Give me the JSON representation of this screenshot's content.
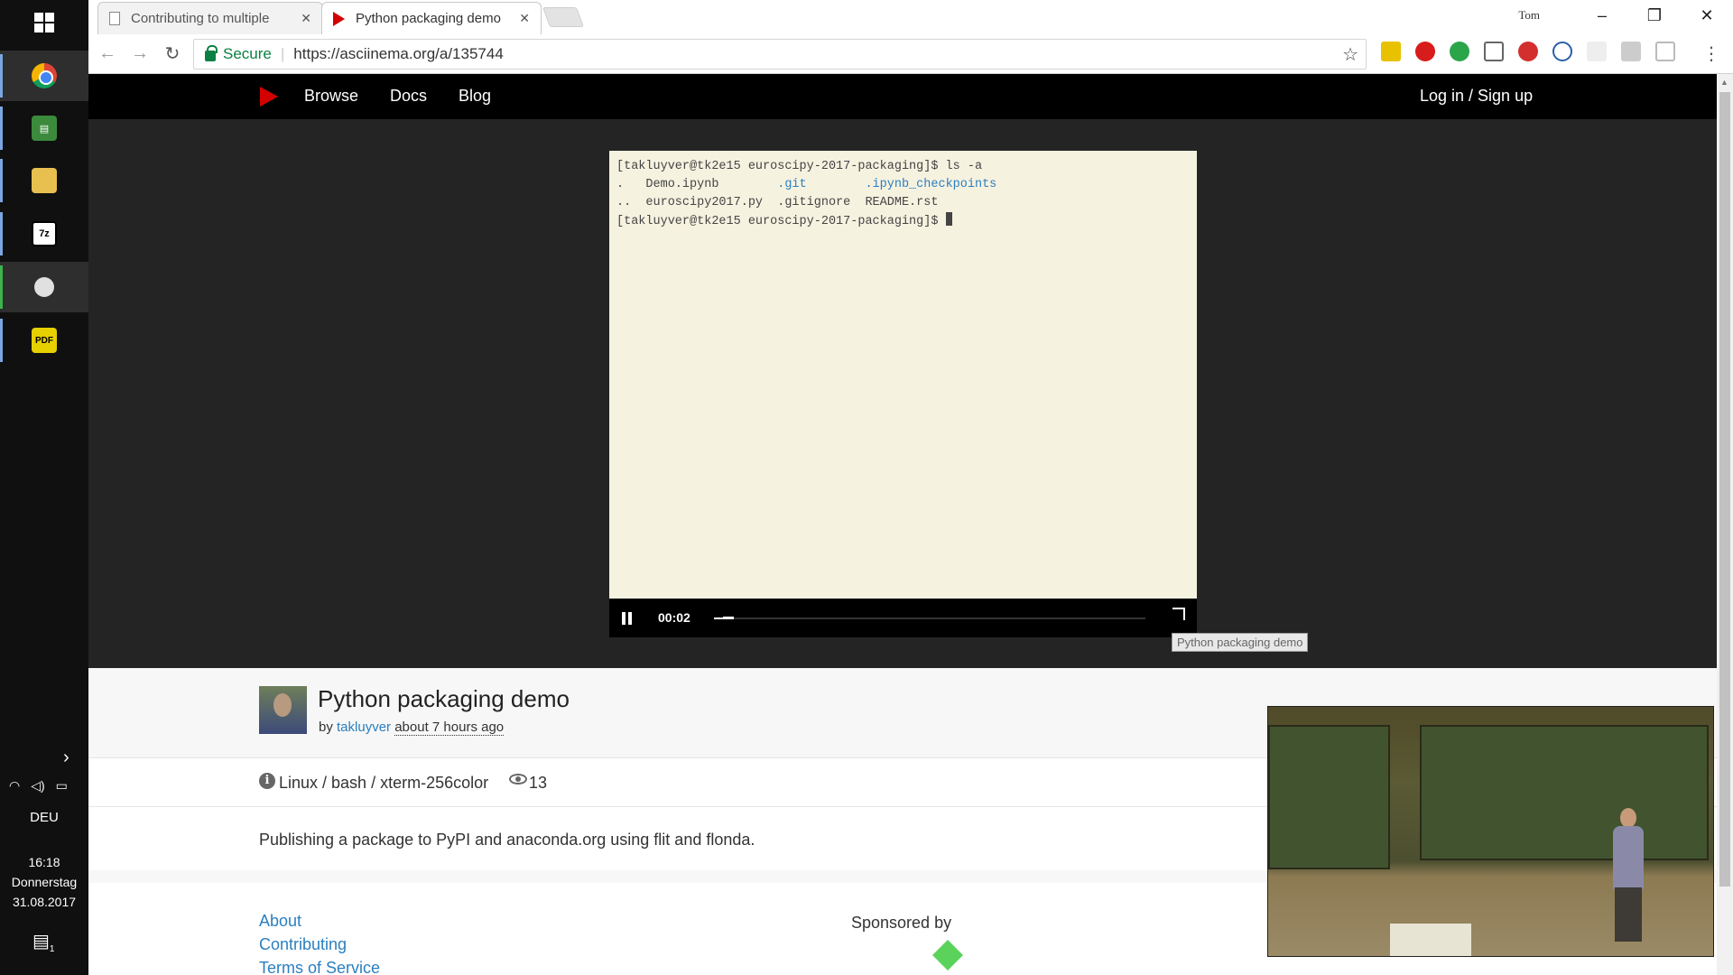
{
  "taskbar": {
    "apps": [
      "chrome",
      "spreadsheet",
      "file-explorer",
      "7zip",
      "media-player",
      "pdf-reader"
    ],
    "language": "DEU",
    "time": "16:18",
    "day": "Donnerstag",
    "date": "31.08.2017",
    "notifications": "1"
  },
  "browser": {
    "tabs": [
      {
        "title": "Contributing to multiple",
        "active": false
      },
      {
        "title": "Python packaging demo",
        "active": true
      }
    ],
    "user": "Tom",
    "secure_label": "Secure",
    "url": "https://asciinema.org/a/135744"
  },
  "site": {
    "nav": [
      "Browse",
      "Docs",
      "Blog"
    ],
    "login": "Log in / Sign up"
  },
  "terminal": {
    "line1": "[takluyver@tk2e15 euroscipy-2017-packaging]$ ls -a",
    "line2a": ".   Demo.ipynb        ",
    "line2b": ".git",
    "line2c": "        ",
    "line2d": ".ipynb_checkpoints",
    "line3": "..  euroscipy2017.py  .gitignore  README.rst",
    "line4": "[takluyver@tk2e15 euroscipy-2017-packaging]$ ",
    "time": "00:02",
    "progress_fraction": 0.02,
    "tooltip": "Python packaging demo"
  },
  "asciicast": {
    "title": "Python packaging demo",
    "by": "by",
    "author": "takluyver",
    "when": "about 7 hours ago",
    "env": "Linux / bash / xterm-256color",
    "views": "13",
    "description": "Publishing a package to PyPI and anaconda.org using flit and flonda."
  },
  "footer": {
    "links": [
      "About",
      "Contributing",
      "Terms of Service"
    ],
    "sponsored": "Sponsored by"
  }
}
